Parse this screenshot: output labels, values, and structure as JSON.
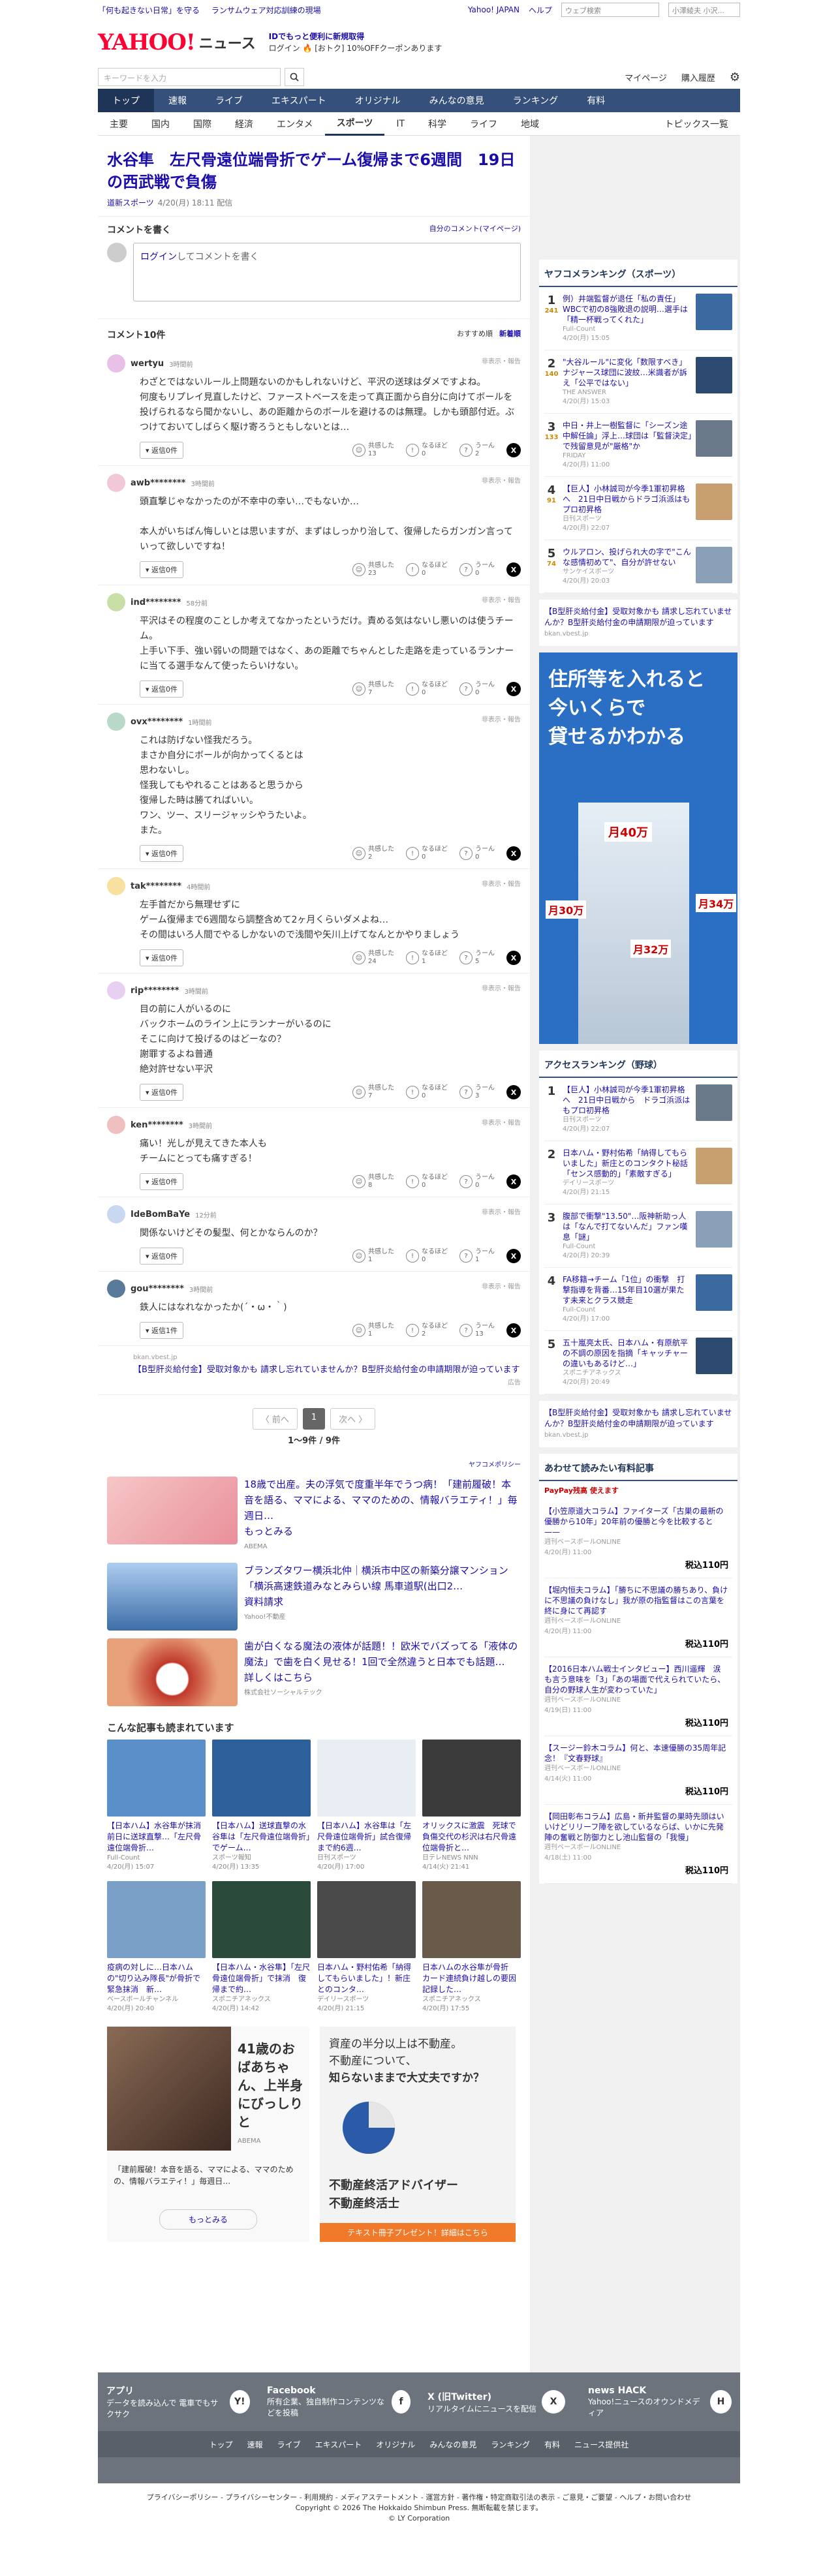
{
  "topbar": {
    "link1": "「何も起きない日常」を守る",
    "link2": "ランサムウェア対応訓練の現場",
    "yj": "Yahoo! JAPAN",
    "help": "ヘルプ",
    "search_ph": "ウェブ検索",
    "mini_val": "小澤綾夫 小沢..."
  },
  "header": {
    "logo": "YAHOO!",
    "logo_sub": "ニュース",
    "promo1": "IDでもっと便利に新規取得",
    "promo2": "ログイン 🔥 [おトク] 10%OFFクーポンあります"
  },
  "search": {
    "placeholder": "キーワードを入力",
    "mypage": "マイページ",
    "history": "購入履歴"
  },
  "nav1": [
    "トップ",
    "速報",
    "ライブ",
    "エキスパート",
    "オリジナル",
    "みんなの意見",
    "ランキング",
    "有料"
  ],
  "nav2": [
    "主要",
    "国内",
    "国際",
    "経済",
    "エンタメ",
    "スポーツ",
    "IT",
    "科学",
    "ライフ",
    "地域"
  ],
  "nav2_right": "トピックス一覧",
  "article": {
    "title": "水谷隼　左尺骨遠位端骨折でゲーム復帰まで6週間　19日の西武戦で負傷",
    "source": "道新スポーツ",
    "date": "4/20(月) 18:11 配信"
  },
  "comment_box": {
    "title": "コメントを書く",
    "mine": "自分のコメント(マイページ)",
    "login": "ログイン",
    "placeholder": "してコメントを書く"
  },
  "clist": {
    "title": "コメント10件",
    "sort_rec": "おすすめ順",
    "sort_new": "新着順"
  },
  "labels": {
    "report": "非表示・報告",
    "empathy": "共感した",
    "nallow": "なるほど",
    "u": "うーん"
  },
  "comments": [
    {
      "name": "wertyu",
      "time": "3時間前",
      "text": "わざとではないルール上問題ないのかもしれないけど、平沢の送球はダメですよね。\n何度もリプレイ見直したけど、ファーストベースを走って真正面から自分に向けてボールを投げられるなら聞かないし、あの距離からのボールを避けるのは無理。しかも頭部付近。ぶつけておいてしばらく駆け寄ろうともしないとは…",
      "reply": "返信0件",
      "e": "13",
      "n": "0",
      "u": "2"
    },
    {
      "name": "awb********",
      "time": "3時間前",
      "text": "頭直撃じゃなかったのが不幸中の幸い…でもないか…\n\n本人がいちばん悔しいとは思いますが、まずはしっかり治して、復帰したらガンガン言っていって欲しいですね！",
      "reply": "返信0件",
      "e": "23",
      "n": "0",
      "u": "0"
    },
    {
      "name": "ind********",
      "time": "58分前",
      "text": "平沢はその程度のことしか考えてなかったというだけ。責める気はないし悪いのは使うチーム。\n上手い下手、強い弱いの問題ではなく、あの距離でちゃんとした走路を走っているランナーに当てる選手なんて使ったらいけない。",
      "reply": "返信0件",
      "e": "7",
      "n": "0",
      "u": "0"
    },
    {
      "name": "ovx********",
      "time": "1時間前",
      "text": "これは防げない怪我だろう。\nまさか自分にボールが向かってくるとは\n思わないし。\n怪我してもやれることはあると思うから\n復帰した時は勝てればいい。\nワン、ツー、スリージャッシやうたいよ。\nまた。",
      "reply": "返信0件",
      "e": "2",
      "n": "0",
      "u": "0"
    },
    {
      "name": "tak********",
      "time": "4時間前",
      "text": "左手首だから無理せずに\nゲーム復帰まで6週間なら調整含めて2ヶ月くらいダメよね…\nその間はいろ人間でやるしかないので浅間や矢川上げてなんとかやりましょう",
      "reply": "返信0件",
      "e": "24",
      "n": "1",
      "u": "5"
    },
    {
      "name": "rip********",
      "time": "3時間前",
      "text": "目の前に人がいるのに\nバックホームのライン上にランナーがいるのに\nそこに向けて投げるのはどーなの？\n謝罪するよね普通\n絶対許せない平沢",
      "reply": "返信0件",
      "e": "7",
      "n": "0",
      "u": "3"
    },
    {
      "name": "ken********",
      "time": "3時間前",
      "text": "痛い！光しが見えてきた本人も\nチームにとっても痛すぎる！",
      "reply": "返信0件",
      "e": "8",
      "n": "0",
      "u": "0"
    },
    {
      "name": "IdeBomBaYe",
      "time": "12分前",
      "text": "関係ないけどその髪型、何とかならんのか？",
      "reply": "返信0件",
      "e": "1",
      "n": "0",
      "u": "1"
    },
    {
      "name": "gou********",
      "time": "3時間前",
      "text": "鉄人にはなれなかったか(´・ω・｀)",
      "reply": "返信1件",
      "e": "1",
      "n": "2",
      "u": "13"
    }
  ],
  "pr": {
    "src": "bkan.vbest.jp",
    "text": "【B型肝炎給付金】受取対象かも 請求し忘れていませんか？B型肝炎給付金の申請期限が迫っています",
    "ad": "広告"
  },
  "pager": {
    "prev": "〈 前へ",
    "cur": "1",
    "next": "次へ 〉",
    "count": "1～9件 / 9件"
  },
  "policy": "ヤフコメポリシー",
  "ads": [
    {
      "text": "18歳で出産。夫の浮気で度重半年でうつ病！「建前履破！本音を語る、ママによる、ママのための、情報バラエティ！」毎週日…",
      "more": "もっとみる",
      "src": "ABEMA"
    },
    {
      "text": "ブランズタワー横浜北仲｜横浜市中区の新築分譲マンション「横浜高速鉄道みなとみらい線 馬車道駅(出口2…",
      "more": "資料請求",
      "src": "Yahoo!不動産"
    },
    {
      "text": "歯が白くなる魔法の液体が話題！！欧米でバズってる「液体の魔法」で歯を白く見せる！1回で全然違うと日本でも話題…",
      "more": "詳しくはこちら",
      "src": "株式会社ソーシャルテック"
    }
  ],
  "readmore": {
    "title": "こんな記事も読まれています",
    "items": [
      {
        "t": "【日本ハム】水谷隼が抹消　前日に送球直撃…「左尺骨遠位端骨折…",
        "s": "Full-Count",
        "d": "4/20(月) 15:07"
      },
      {
        "t": "【日本ハム】送球直撃の水谷隼は「左尺骨遠位端骨折」でゲーム…",
        "s": "スポーツ報知",
        "d": "4/20(月) 13:35"
      },
      {
        "t": "【日本ハム】水谷隼は「左尺骨遠位端骨折」試合復帰まで約6週…",
        "s": "日刊スポーツ",
        "d": "4/20(月) 17:00"
      },
      {
        "t": "オリックスに激震　死球で負傷交代の杉沢は右尺骨遠位端骨折と…",
        "s": "日テレNEWS NNN",
        "d": "4/14(火) 21:41"
      },
      {
        "t": "疫病の対しに…日本ハムの\"切り込み隊長\"が骨折で緊急抹消　新…",
        "s": "ベースボールチャンネル",
        "d": "4/20(月) 20:40"
      },
      {
        "t": "【日本ハム・水谷隼】「左尺骨遠位端骨折」で抹消　復帰まで約…",
        "s": "スポニチアネックス",
        "d": "4/20(月) 14:42"
      },
      {
        "t": "日本ハム・野村佑希「納得してもらいました」！新庄とのコンタ…",
        "s": "デイリースポーツ",
        "d": "4/20(月) 21:15"
      },
      {
        "t": "日本ハムの水谷隼が骨折　カード連続負け越しの要因　記録した…",
        "s": "スポニチアネックス",
        "d": "4/20(月) 17:55"
      }
    ]
  },
  "bigads": {
    "a1": "41歳のおばあちゃん、上半身にびっしりと",
    "a1src": "ABEMA",
    "a1body": "「建前履破！本音を語る、ママによる、ママのための、情報バラエティ！」毎週日…",
    "a1more": "もっとみる",
    "a2t1": "資産の半分以上は不動産。",
    "a2t2": "不動産について、",
    "a2t3": "知らないままで大丈夫ですか？",
    "a2t4": "不動産終活アドバイザー",
    "a2t5": "不動産終活士",
    "a2btn": "テキスト冊子プレゼント！詳細はこちら"
  },
  "side": {
    "rank_title": "ヤフコメランキング（スポーツ）",
    "rank": [
      {
        "n": "1",
        "c": "241",
        "t": "例）井端監督が退任「私の責任」WBCで初の8強敗退の説明…選手は「精一杯戦ってくれた」",
        "s": "Full-Count",
        "d": "4/20(月) 15:05"
      },
      {
        "n": "2",
        "c": "140",
        "t": "\"大谷ルール\"に変化「数限すべき」ナジャース球団に波紋…米識者が訴え「公平ではない」",
        "s": "THE ANSWER",
        "d": "4/20(月) 15:03"
      },
      {
        "n": "3",
        "c": "133",
        "t": "中日・井上一樹監督に「シーズン途中解任論」浮上…球団は「監督決定」で残留意見が\"厳格\"か",
        "s": "FRIDAY",
        "d": "4/20(月) 11:00"
      },
      {
        "n": "4",
        "c": "91",
        "t": "【巨人】小林誠司が今季1軍初昇格へ　21日中日戦からドラゴ浜派はもプロ初昇格",
        "s": "日刊スポーツ",
        "d": "4/20(月) 22:07"
      },
      {
        "n": "5",
        "c": "74",
        "t": "ウルアロン、投げられ大の字で\"こんな感情初めて\"、自分が許せない",
        "s": "サンケイスポーツ",
        "d": "4/20(月) 20:03"
      }
    ],
    "pr_src": "bkan.vbest.jp",
    "pr_text": "【B型肝炎給付金】受取対象かも 請求し忘れていませんか？B型肝炎給付金の申請期限が迫っています",
    "ad_h1": "住所等を入れると",
    "ad_h2": "今いくらで",
    "ad_h3": "貸せるかわかる",
    "ad_p1": "月40万",
    "ad_p2": "月30万",
    "ad_p3": "月34万",
    "ad_p4": "月32万",
    "access_title": "アクセスランキング（野球）",
    "access": [
      {
        "n": "1",
        "t": "【巨人】小林誠司が今季1軍初昇格へ　21日中日戦から　ドラゴ浜派はもプロ初昇格",
        "s": "日刊スポーツ",
        "d": "4/20(月) 22:07"
      },
      {
        "n": "2",
        "t": "日本ハム・野村佑希「納得してもらいました」新庄とのコンタクト秘話「センス感動的」「素敵すぎる」",
        "s": "デイリースポーツ",
        "d": "4/20(月) 21:15"
      },
      {
        "n": "3",
        "t": "腹部で衝撃\"13.50\"…阪神新助っ人は「なんで打てないんだ」ファン嘆息「謎」",
        "s": "Full-Count",
        "d": "4/20(月) 20:39"
      },
      {
        "n": "4",
        "t": "FA移籍→チーム「1位」の衝撃　打撃指導を背番…15年目10選が果たす未来とクラス競走",
        "s": "Full-Count",
        "d": "4/20(月) 17:00"
      },
      {
        "n": "5",
        "t": "五十嵐亮太氏、日本ハム・有原航平の不調の原因を指摘「キャッチャーの違いもあるけど…」",
        "s": "スポニチアネックス",
        "d": "4/20(月) 20:49"
      }
    ],
    "paid_title": "あわせて読みたい有料記事",
    "paid_sub": "PayPay残高 使えます",
    "paid": [
      {
        "t": "【小笠原道大コラム】ファイターズ「古巣の最新の優勝から10年」20年前の優勝と今を比較すると——",
        "s": "週刊ベースボールONLINE",
        "d": "4/20(月) 11:00",
        "p": "税込110円"
      },
      {
        "t": "【堀内恒夫コラム】「勝ちに不思議の勝ちあり、負けに不思議の負けなし」我が原の指監督はこの言葉を終に身にて再認す",
        "s": "週刊ベースボールONLINE",
        "d": "4/20(月) 11:00",
        "p": "税込110円"
      },
      {
        "t": "【2016日本ハム戦士インタビュー】西川遥輝　涙も言う意味を「3」「あの場面で代えられていたら、自分の野球人生が変わっていた」",
        "s": "週刊ベースボールONLINE",
        "d": "4/19(日) 11:00",
        "p": "税込110円"
      },
      {
        "t": "【スージー鈴木コラム】何と、本速優勝の35周年記念！『文春野球』",
        "s": "週刊ベースボールONLINE",
        "d": "4/14(火) 11:00",
        "p": "税込110円"
      },
      {
        "t": "【岡田彰布コラム】広島・新井監督の巣時先頭はいいけどリリーフ陣を欲しているならば、いかに先発陣の奮戦と防御力とし池山監督の「我慢」",
        "s": "週刊ベースボールONLINE",
        "d": "4/18(土) 11:00",
        "p": "税込110円"
      }
    ]
  },
  "footer": {
    "items": [
      {
        "h": "アプリ",
        "d": "データを読み込んで 電車でもサクサク",
        "ic": "Y!"
      },
      {
        "h": "Facebook",
        "d": "所有企業、独自制作コンテンツなどを投稿",
        "ic": "f"
      },
      {
        "h": "X (旧Twitter)",
        "d": "リアルタイムにニュースを配信",
        "ic": "X"
      },
      {
        "h": "news HACK",
        "d": "Yahoo!ニュースのオウンドメディア",
        "ic": "H"
      }
    ],
    "nav": [
      "トップ",
      "速報",
      "ライブ",
      "エキスパート",
      "オリジナル",
      "みんなの意見",
      "ランキング",
      "有料",
      "ニュース提供社"
    ],
    "copy1": "プライバシーポリシー - プライバシーセンター - 利用規約 - メディアステートメント - 運営方針 - 著作権・特定商取引法の表示 - ご意見・ご要望 - ヘルプ・お問い合わせ",
    "copy2": "Copyright © 2026 The Hokkaido Shimbun Press. 無断転載を禁じます。",
    "copy3": "© LY Corporation"
  }
}
